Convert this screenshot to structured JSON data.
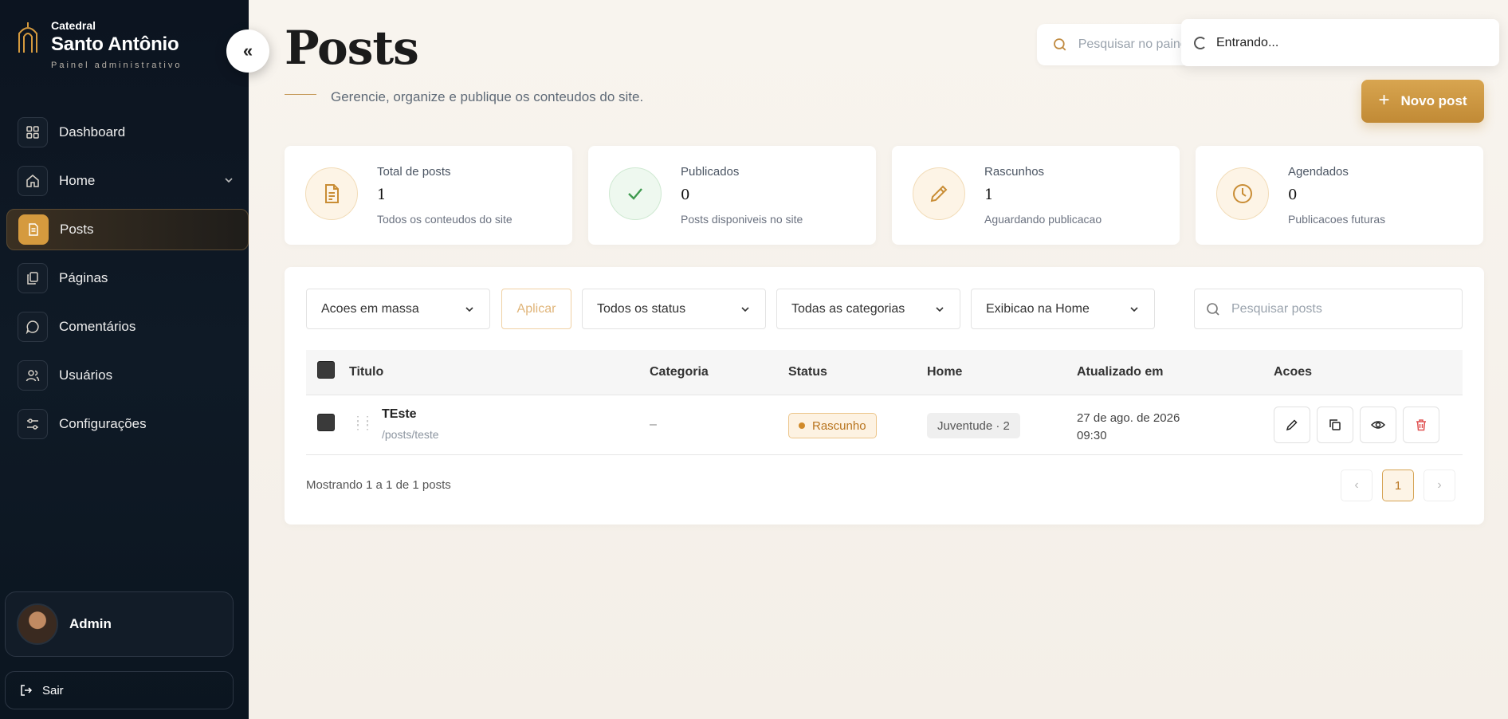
{
  "brand": {
    "small": "Catedral",
    "name": "Santo Antônio",
    "subtitle": "Painel administrativo"
  },
  "sidebar": {
    "items": [
      {
        "label": "Dashboard",
        "icon": "grid-icon"
      },
      {
        "label": "Home",
        "icon": "home-icon"
      },
      {
        "label": "Posts",
        "icon": "document-icon"
      },
      {
        "label": "Páginas",
        "icon": "pages-icon"
      },
      {
        "label": "Comentários",
        "icon": "comment-icon"
      },
      {
        "label": "Usuários",
        "icon": "users-icon"
      },
      {
        "label": "Configurações",
        "icon": "settings-icon"
      }
    ],
    "active": "Posts",
    "user": {
      "name": "Admin"
    },
    "logout_label": "Sair"
  },
  "header": {
    "title": "Posts",
    "subtitle": "Gerencie, organize e publique os conteudos do site.",
    "search_placeholder": "Pesquisar no painel",
    "toast": "Entrando...",
    "new_post_label": "Novo post"
  },
  "stats": [
    {
      "label": "Total de posts",
      "value": "1",
      "desc": "Todos os conteudos do site",
      "icon": "document-icon"
    },
    {
      "label": "Publicados",
      "value": "0",
      "desc": "Posts disponiveis no site",
      "icon": "check-icon"
    },
    {
      "label": "Rascunhos",
      "value": "1",
      "desc": "Aguardando publicacao",
      "icon": "pencil-icon"
    },
    {
      "label": "Agendados",
      "value": "0",
      "desc": "Publicacoes futuras",
      "icon": "clock-icon"
    }
  ],
  "filters": {
    "bulk": "Acoes em massa",
    "apply": "Aplicar",
    "status": "Todos os status",
    "categories": "Todas as categorias",
    "home": "Exibicao na Home",
    "search_placeholder": "Pesquisar posts"
  },
  "table": {
    "columns": [
      "Titulo",
      "Categoria",
      "Status",
      "Home",
      "Atualizado em",
      "Acoes"
    ],
    "rows": [
      {
        "title": "TEste",
        "slug": "/posts/teste",
        "category": "–",
        "status": "Rascunho",
        "home": "Juventude · 2",
        "updated_date": "27 de ago. de 2026",
        "updated_time": "09:30"
      }
    ],
    "footer": "Mostrando 1 a 1 de 1 posts",
    "current_page": "1"
  },
  "colors": {
    "accent": "#c99240",
    "sidebar_bg": "#0c1420",
    "delete": "#e05252",
    "success": "#4caf50"
  }
}
